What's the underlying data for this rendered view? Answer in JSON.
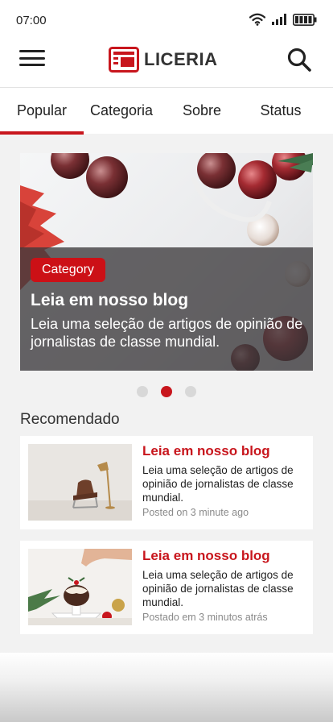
{
  "status_bar": {
    "time": "07:00"
  },
  "header": {
    "logo_text": "LICERIA"
  },
  "tabs": [
    {
      "label": "Popular",
      "active": true
    },
    {
      "label": "Categoria",
      "active": false
    },
    {
      "label": "Sobre",
      "active": false
    },
    {
      "label": "Status",
      "active": false
    }
  ],
  "hero": {
    "category": "Category",
    "title": "Leia em nosso blog",
    "description": "Leia uma seleção de artigos de opinião de jornalistas de classe mundial."
  },
  "carousel": {
    "count": 3,
    "active_index": 1
  },
  "recommended": {
    "title": "Recomendado",
    "items": [
      {
        "title": "Leia em nosso blog",
        "description": "Leia uma seleção de artigos de opinião de jornalistas de classe mundial.",
        "meta": "Posted on 3 minute ago"
      },
      {
        "title": "Leia em nosso blog",
        "description": "Leia uma seleção de artigos de opinião de jornalistas de classe mundial.",
        "meta": "Postado em 3 minutos atrás"
      }
    ]
  },
  "colors": {
    "accent": "#c8161d",
    "badge": "#cc1016",
    "background": "#f2f2f2"
  },
  "icons": [
    "wifi-icon",
    "signal-icon",
    "battery-icon",
    "menu-icon",
    "newspaper-icon",
    "search-icon"
  ]
}
